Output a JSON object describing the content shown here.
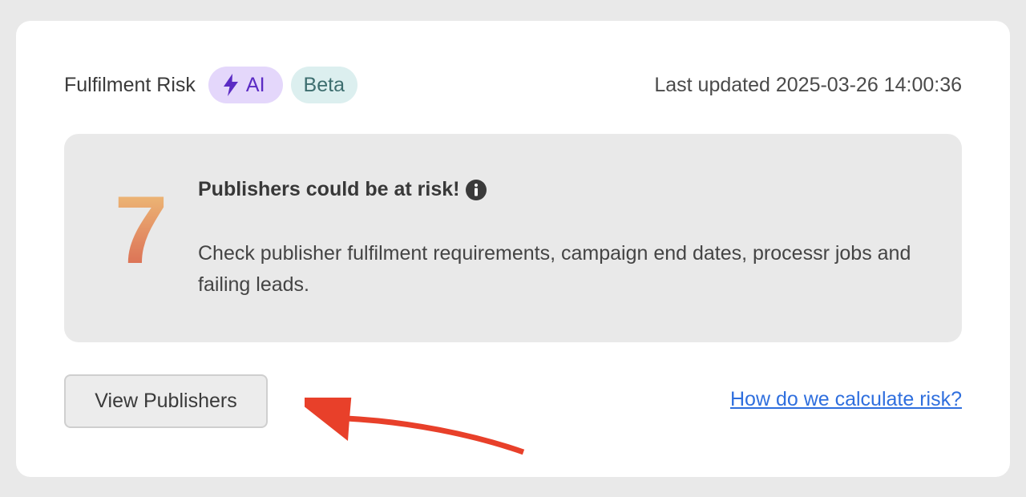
{
  "header": {
    "title": "Fulfilment Risk",
    "ai_badge": "AI",
    "beta_badge": "Beta",
    "last_updated": "Last updated 2025-03-26 14:00:36"
  },
  "risk": {
    "count": "7",
    "heading": "Publishers could be at risk!",
    "description": "Check publisher fulfilment requirements, campaign end dates, processr jobs and failing leads."
  },
  "actions": {
    "view_button": "View Publishers",
    "help_link": "How do we calculate risk?"
  },
  "colors": {
    "ai_badge_bg": "#e4d7fb",
    "ai_badge_text": "#5b2bc4",
    "beta_badge_bg": "#dcefef",
    "beta_badge_text": "#3d6e6f",
    "link": "#2f6fde",
    "annotation_arrow": "#e8402a",
    "count_gradient_top": "#efc27a",
    "count_gradient_bottom": "#d8664f"
  },
  "icons": {
    "ai_badge_icon": "lightning-bolt-icon",
    "heading_icon": "info-icon",
    "annotation": "annotation-arrow-icon"
  }
}
